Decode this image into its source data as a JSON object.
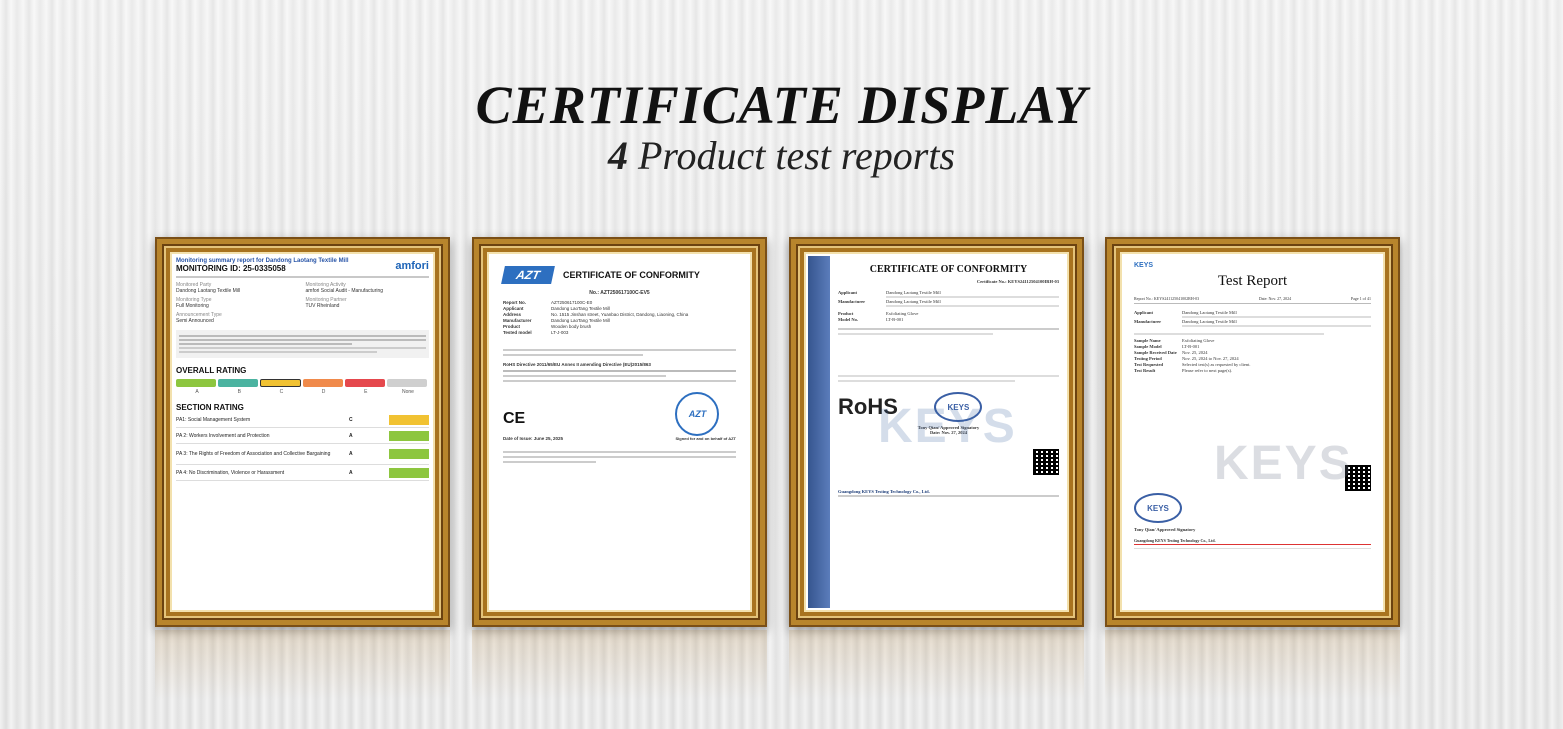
{
  "header": {
    "title": "CERTIFICATE DISPLAY",
    "subtitle_count": "4",
    "subtitle_text": "Product test reports"
  },
  "cert1": {
    "top": "Monitoring summary report for Dandong Laotang Textile Mill",
    "id": "MONITORING ID: 25-0335058",
    "logo": "amfori",
    "fields": [
      {
        "k": "Monitored Party",
        "v": "Dandong Laotang Textile Mill"
      },
      {
        "k": "Monitoring Activity",
        "v": "amfori Social Audit - Manufacturing"
      },
      {
        "k": "Monitoring Type",
        "v": "Full Monitoring"
      },
      {
        "k": "Monitoring Partner",
        "v": "TUV Rheinland"
      },
      {
        "k": "Announcement Type",
        "v": "Semi Announced"
      }
    ],
    "overall_rating": "OVERALL RATING",
    "grades": [
      "A",
      "B",
      "C",
      "D",
      "E",
      "None"
    ],
    "section_rating": "SECTION RATING",
    "sections": [
      {
        "t": "PA1: Social Management System",
        "g": "C",
        "color": "#f1c232"
      },
      {
        "t": "PA 2: Workers Involvement and Protection",
        "g": "A",
        "color": "#8dc63f"
      },
      {
        "t": "PA 3: The Rights of Freedom of Association and Collective Bargaining",
        "g": "A",
        "color": "#8dc63f"
      },
      {
        "t": "PA 4: No Discrimination, Violence or Harassment",
        "g": "A",
        "color": "#8dc63f"
      }
    ]
  },
  "cert2": {
    "logo": "AZT",
    "title": "CERTIFICATE OF CONFORMITY",
    "number": "No.: AZT250617100C-EV5",
    "fields": [
      {
        "k": "Report No.",
        "v": "AZT250617100C-E0"
      },
      {
        "k": "Applicant",
        "v": "Dandong LaoTang Textile Mill"
      },
      {
        "k": "Address",
        "v": "No. 1515 Jinshan street, Yuanbao District, Dandong, Liaoning, China"
      },
      {
        "k": "Manufacturer",
        "v": "Dandong LaoTang Textile Mill"
      },
      {
        "k": "Product",
        "v": "Wooden body brush"
      },
      {
        "k": "Tested model",
        "v": "LT-J-003"
      }
    ],
    "directive": "RoHS Directive 2011/65/EU Annex II amending Directive (EU)2015/863",
    "ce": "CE",
    "date": "Date of Issue:   June 25, 2025",
    "sign": "Signed for and on behalf of AZT"
  },
  "cert3": {
    "title": "CERTIFICATE OF CONFORMITY",
    "number": "Certificate No.: KEYS24112504100IRH-03",
    "fields": [
      {
        "k": "Applicant",
        "v": "Dandong Laotang Textile Mill"
      },
      {
        "k": "Manufacturer",
        "v": "Dandong Laotang Textile Mill"
      },
      {
        "k": "Product",
        "v": "Exfoliating Glove"
      },
      {
        "k": "Model No.",
        "v": "LT-B-001"
      }
    ],
    "watermark": "KEYS",
    "rohs": "RoHS",
    "stamp": "KEYS",
    "signatory": "Tony Qian/ Approved Signatory",
    "date": "Date: Nov. 27, 2024",
    "footer": "Guangdong KEYS Testing Technology Co., Ltd."
  },
  "cert4": {
    "logo": "KEYS",
    "title": "Test Report",
    "report_no": "Report No.: KEYS241125041002RH-03",
    "date": "Date: Nov. 27, 2024",
    "page": "Page 1 of 41",
    "fields": [
      {
        "k": "Applicant",
        "v": "Dandong Laotang Textile Mill"
      },
      {
        "k": "Manufacturer",
        "v": "Dandong Laotang Textile Mill"
      },
      {
        "k": "Sample Name",
        "v": "Exfoliating Glove"
      },
      {
        "k": "Sample Model",
        "v": "LT-B-001"
      },
      {
        "k": "Sample Received Date",
        "v": "Nov. 25, 2024"
      },
      {
        "k": "Testing Period",
        "v": "Nov. 25, 2024 to Nov. 27, 2024"
      },
      {
        "k": "Test Requested",
        "v": "Selected test(s) as requested by client."
      },
      {
        "k": "Test Result",
        "v": "Please refer to next page(s)."
      }
    ],
    "watermark": "KEYS",
    "signatory": "Tony Qian/ Approved Signatory",
    "footer": "Guangdong KEYS Testing Technology Co., Ltd."
  }
}
